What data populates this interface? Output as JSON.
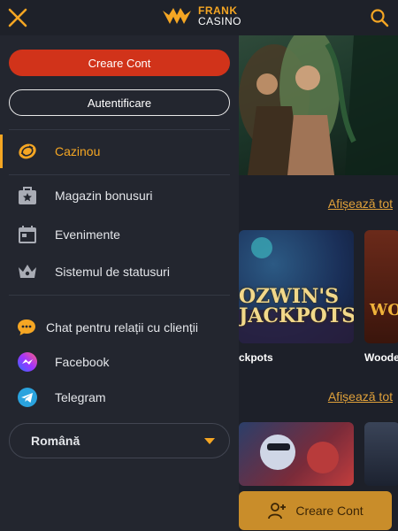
{
  "header": {
    "logo_top": "FRANK",
    "logo_bottom": "CASINO"
  },
  "drawer": {
    "register_label": "Creare Cont",
    "login_label": "Autentificare",
    "menu": [
      {
        "label": "Cazinou",
        "icon": "coins-icon",
        "active": true
      },
      {
        "label": "Magazin bonusuri",
        "icon": "bonus-shop-icon"
      },
      {
        "label": "Evenimente",
        "icon": "calendar-icon"
      },
      {
        "label": "Sistemul de statusuri",
        "icon": "crown-icon"
      }
    ],
    "support": [
      {
        "label": "Chat pentru relații cu clienții",
        "icon": "chat-icon"
      },
      {
        "label": "Facebook",
        "icon": "messenger-icon"
      },
      {
        "label": "Telegram",
        "icon": "telegram-icon"
      }
    ],
    "language": "Română"
  },
  "main": {
    "show_all_1": "Afișează tot",
    "show_all_2": "Afișează tot",
    "card_art_1": "OZWIN'S JACKPOTS",
    "card_art_2": "WO",
    "card_label_1": "ckpots",
    "card_label_2": "Woode",
    "cta_label": "Creare Cont"
  },
  "colors": {
    "accent": "#f5a623",
    "register": "#d1331a",
    "drawer_bg": "#23262f",
    "page_bg": "#1b1e25"
  }
}
